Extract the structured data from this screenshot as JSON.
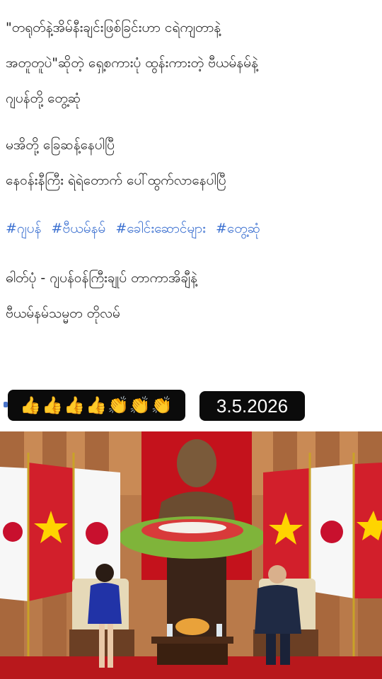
{
  "post": {
    "paragraph1": [
      "\"တရုတ်နဲ့အိမ်နီးချင်းဖြစ်ခြင်းဟာ ငရဲကျတာနဲ့",
      "အတူတူပဲ\"ဆိုတဲ့ ရှေ့စကားပုံ ထွန်းကားတဲ့ ဗီယမ်နမ်နဲ့",
      "ဂျပန်တို့ တွေ့ဆုံ"
    ],
    "paragraph2": [
      "မအိတို့ ခြေဆန့်နေပါပြီ",
      "နေဝန်းနီကြီး ရဲရဲတောက် ပေါ်ထွက်လာနေပါပြီ"
    ],
    "hashtags": [
      "#ဂျပန်",
      "#ဗီယမ်နမ်",
      "#ခေါင်းဆောင်များ",
      "#တွေ့ဆုံ"
    ],
    "caption": [
      "ဓါတ်ပုံ - ဂျပန်ဝန်ကြီးချုပ် တာကာအိချီနဲ့",
      "ဗီယမ်နမ်သမ္မတ တိုလမ်"
    ]
  },
  "badges": {
    "reactions": "👍👍👍👍👏👏👏",
    "date": "3.5.2026"
  },
  "colors": {
    "hashtag": "#3a6fd0",
    "badge_bg": "#0b0b0b",
    "vietnam_red": "#d21f2b",
    "vietnam_star": "#ffd400",
    "japan_red": "#c8102e"
  }
}
